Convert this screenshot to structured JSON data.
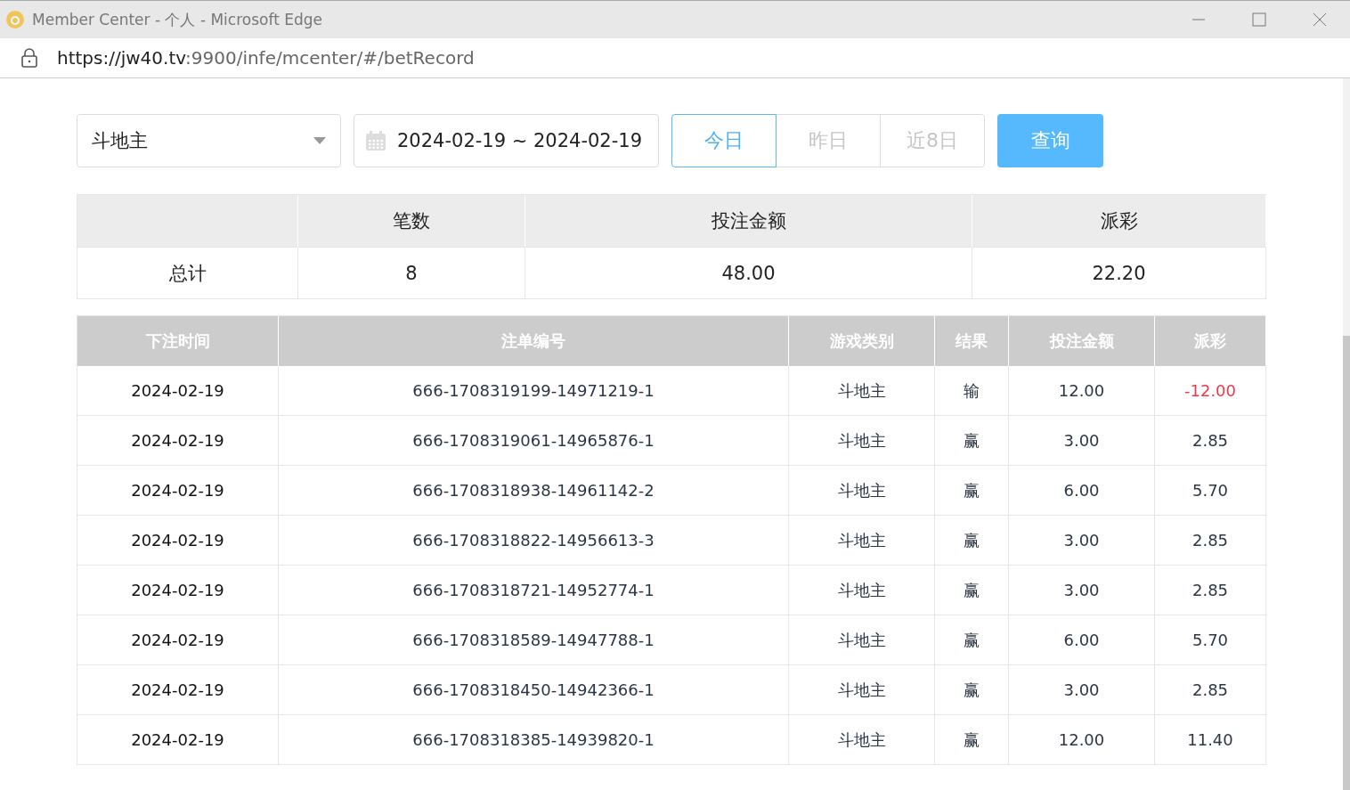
{
  "window": {
    "title": "Member Center - 个人 - Microsoft Edge"
  },
  "address_bar": {
    "url_host": "https://jw40.tv",
    "url_path": ":9900/infe/mcenter/#/betRecord"
  },
  "filters": {
    "game_select": "斗地主",
    "date_range": "2024-02-19 ~ 2024-02-19",
    "quick_ranges": [
      {
        "label": "今日",
        "selected": true
      },
      {
        "label": "昨日",
        "selected": false
      },
      {
        "label": "近8日",
        "selected": false
      }
    ],
    "query_button": "查询"
  },
  "summary": {
    "columns": [
      "笔数",
      "投注金额",
      "派彩"
    ],
    "row_label": "总计",
    "values": [
      "8",
      "48.00",
      "22.20"
    ]
  },
  "table": {
    "columns": [
      "下注时间",
      "注单编号",
      "游戏类别",
      "结果",
      "投注金额",
      "派彩"
    ],
    "rows": [
      {
        "time": "2024-02-19",
        "bet_id": "666-1708319199-14971219-1",
        "game": "斗地主",
        "result": "输",
        "amount": "12.00",
        "payout": "-12.00",
        "negative": true
      },
      {
        "time": "2024-02-19",
        "bet_id": "666-1708319061-14965876-1",
        "game": "斗地主",
        "result": "赢",
        "amount": "3.00",
        "payout": "2.85",
        "negative": false
      },
      {
        "time": "2024-02-19",
        "bet_id": "666-1708318938-14961142-2",
        "game": "斗地主",
        "result": "赢",
        "amount": "6.00",
        "payout": "5.70",
        "negative": false
      },
      {
        "time": "2024-02-19",
        "bet_id": "666-1708318822-14956613-3",
        "game": "斗地主",
        "result": "赢",
        "amount": "3.00",
        "payout": "2.85",
        "negative": false
      },
      {
        "time": "2024-02-19",
        "bet_id": "666-1708318721-14952774-1",
        "game": "斗地主",
        "result": "赢",
        "amount": "3.00",
        "payout": "2.85",
        "negative": false
      },
      {
        "time": "2024-02-19",
        "bet_id": "666-1708318589-14947788-1",
        "game": "斗地主",
        "result": "赢",
        "amount": "6.00",
        "payout": "5.70",
        "negative": false
      },
      {
        "time": "2024-02-19",
        "bet_id": "666-1708318450-14942366-1",
        "game": "斗地主",
        "result": "赢",
        "amount": "3.00",
        "payout": "2.85",
        "negative": false
      },
      {
        "time": "2024-02-19",
        "bet_id": "666-1708318385-14939820-1",
        "game": "斗地主",
        "result": "赢",
        "amount": "12.00",
        "payout": "11.40",
        "negative": false
      }
    ]
  }
}
